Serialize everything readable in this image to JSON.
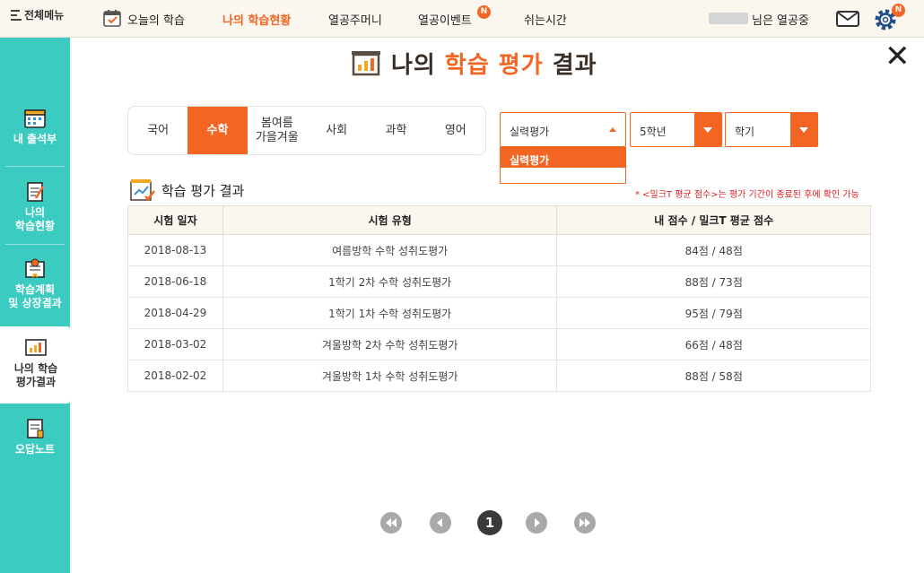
{
  "topbar": {
    "menu_label": "전체메뉴",
    "nav": [
      "오늘의 학습",
      "나의 학습현황",
      "열공주머니",
      "열공이벤트",
      "쉬는시간"
    ],
    "active_nav": "나의 학습현황",
    "event_badge": "N",
    "user_suffix": "님은 열공중",
    "settings_badge": "N"
  },
  "sidebar": {
    "items": [
      {
        "label": "내 출석부",
        "icon": "calendar-icon"
      },
      {
        "label": "나의\n학습현황",
        "icon": "notepad-icon"
      },
      {
        "label": "학습계획\n및 상장결과",
        "icon": "certificate-icon"
      },
      {
        "label": "나의 학습\n평가결과",
        "icon": "chart-board-icon",
        "active": true
      },
      {
        "label": "오답노트",
        "icon": "note-icon"
      }
    ]
  },
  "page": {
    "title_a": "나의 ",
    "title_b": "학습 평가",
    "title_c": " 결과",
    "close_label": "✕"
  },
  "subjects": {
    "tabs": [
      "국어",
      "수학",
      "봄여름\n가을겨울",
      "사회",
      "과학",
      "영어"
    ],
    "active": "수학"
  },
  "filters": {
    "type_value": "실력평가",
    "type_options": [
      "실력평가"
    ],
    "grade_value": "5학년",
    "term_value": "학기"
  },
  "results": {
    "section_title": "학습 평가 결과",
    "note": "* <밀크T 평균 점수>는 평가 기간이 종료된 후에 확인 가능",
    "headers": [
      "시험 일자",
      "시험 유형",
      "내 점수 / 밀크T 평균 점수"
    ],
    "rows": [
      [
        "2018-08-13",
        "여름방학 수학 성취도평가",
        "84점 / 48점"
      ],
      [
        "2018-06-18",
        "1학기 2차 수학 성취도평가",
        "88점 / 73점"
      ],
      [
        "2018-04-29",
        "1학기 1차 수학 성취도평가",
        "95점 / 79점"
      ],
      [
        "2018-03-02",
        "겨울방학 2차 수학 성취도평가",
        "66점 / 48점"
      ],
      [
        "2018-02-02",
        "겨울방학 1차 수학 성취도평가",
        "88점 / 58점"
      ]
    ]
  },
  "pagination": {
    "current": "1"
  },
  "colors": {
    "accent": "#f26522",
    "sidebar": "#3ccbc0",
    "topbar": "#fbf6ee"
  }
}
